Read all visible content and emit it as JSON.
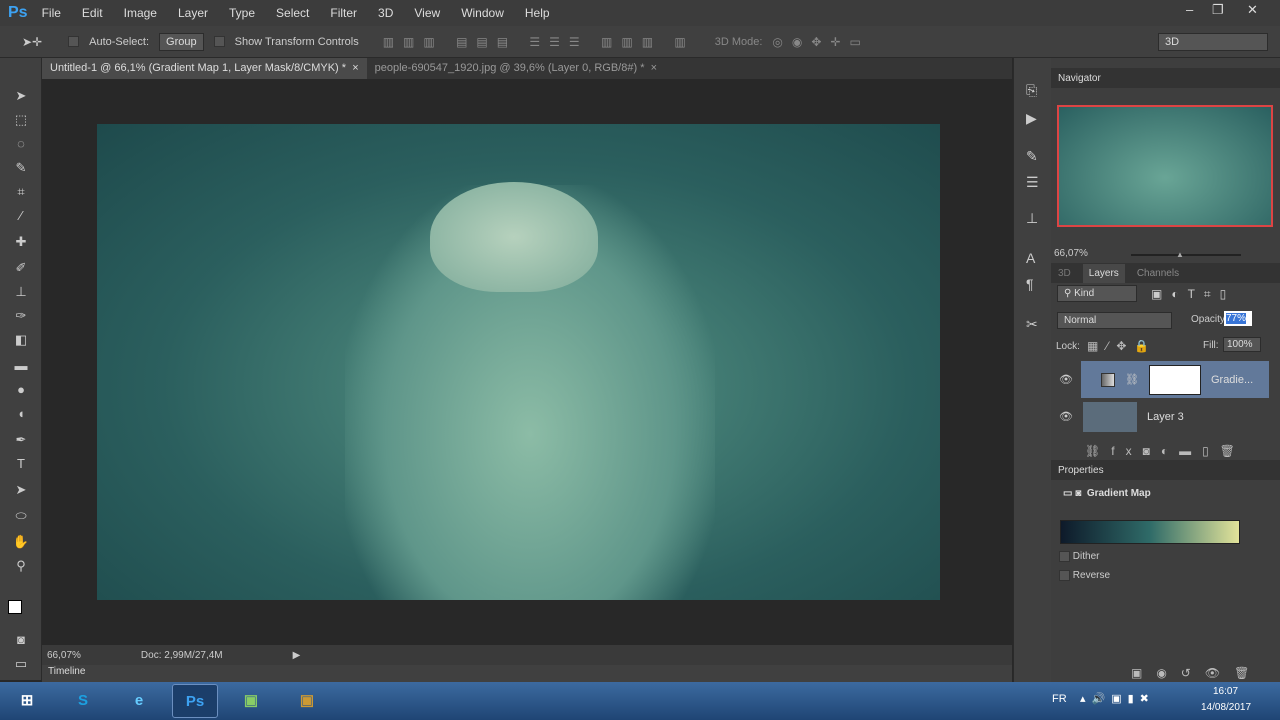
{
  "app": {
    "logo": "Ps",
    "menu": [
      "File",
      "Edit",
      "Image",
      "Layer",
      "Type",
      "Select",
      "Filter",
      "3D",
      "View",
      "Window",
      "Help"
    ],
    "window_controls": [
      "–",
      "❐",
      "✕"
    ]
  },
  "options": {
    "auto_select": "Auto-Select:",
    "group": "Group",
    "show_transform": "Show Transform Controls",
    "mode_3d": "3D Mode:",
    "workspace": "3D"
  },
  "tabs": [
    {
      "label": "Untitled-1 @ 66,1% (Gradient Map 1, Layer Mask/8/CMYK) *",
      "close": "×"
    },
    {
      "label": "people-690547_1920.jpg @ 39,6% (Layer 0, RGB/8#) *",
      "close": "×"
    }
  ],
  "status": {
    "zoom": "66,07%",
    "doc": "Doc: 2,99M/27,4M"
  },
  "timeline": "Timeline",
  "navigator": {
    "title": "Navigator",
    "zoom": "66,07%"
  },
  "layers_panel": {
    "tabs": [
      "3D",
      "Layers",
      "Channels"
    ],
    "filter": "Kind",
    "blend": "Normal",
    "opacity_label": "Opacity:",
    "opacity": "77%",
    "lock_label": "Lock:",
    "fill_label": "Fill:",
    "fill": "100%",
    "layers": [
      {
        "name": "Gradie..."
      },
      {
        "name": "Layer 3"
      }
    ]
  },
  "properties": {
    "title": "Properties",
    "type": "Gradient Map",
    "dither": "Dither",
    "reverse": "Reverse",
    "gradient_colors": [
      "#0e1a2a",
      "#2f6b68",
      "#e2e39a"
    ]
  },
  "taskbar": {
    "lang": "FR",
    "time": "16:07",
    "date": "14/08/2017",
    "apps": [
      "⊞",
      "S",
      "e",
      "Ps",
      "▣",
      "▣"
    ]
  }
}
